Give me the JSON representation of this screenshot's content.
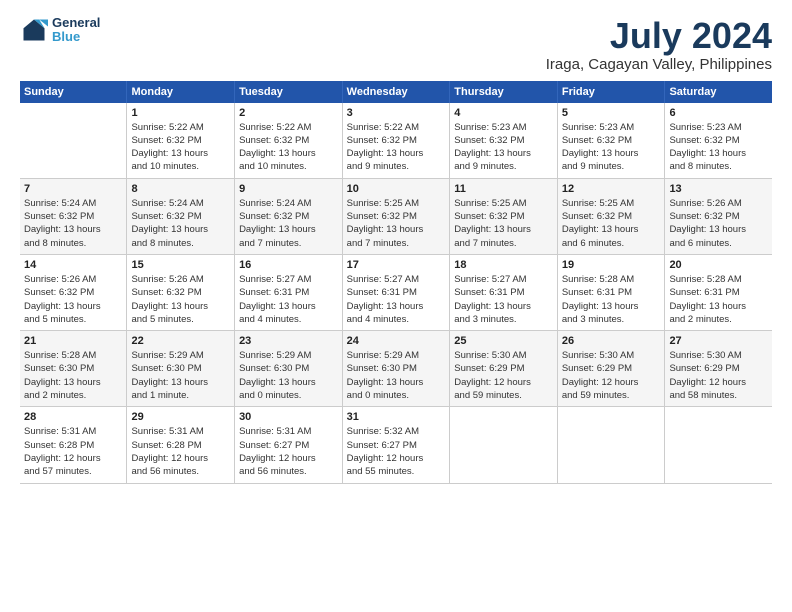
{
  "header": {
    "logo_line1": "General",
    "logo_line2": "Blue",
    "month_title": "July 2024",
    "location": "Iraga, Cagayan Valley, Philippines"
  },
  "days_of_week": [
    "Sunday",
    "Monday",
    "Tuesday",
    "Wednesday",
    "Thursday",
    "Friday",
    "Saturday"
  ],
  "weeks": [
    [
      {
        "num": "",
        "info": ""
      },
      {
        "num": "1",
        "info": "Sunrise: 5:22 AM\nSunset: 6:32 PM\nDaylight: 13 hours\nand 10 minutes."
      },
      {
        "num": "2",
        "info": "Sunrise: 5:22 AM\nSunset: 6:32 PM\nDaylight: 13 hours\nand 10 minutes."
      },
      {
        "num": "3",
        "info": "Sunrise: 5:22 AM\nSunset: 6:32 PM\nDaylight: 13 hours\nand 9 minutes."
      },
      {
        "num": "4",
        "info": "Sunrise: 5:23 AM\nSunset: 6:32 PM\nDaylight: 13 hours\nand 9 minutes."
      },
      {
        "num": "5",
        "info": "Sunrise: 5:23 AM\nSunset: 6:32 PM\nDaylight: 13 hours\nand 9 minutes."
      },
      {
        "num": "6",
        "info": "Sunrise: 5:23 AM\nSunset: 6:32 PM\nDaylight: 13 hours\nand 8 minutes."
      }
    ],
    [
      {
        "num": "7",
        "info": "Sunrise: 5:24 AM\nSunset: 6:32 PM\nDaylight: 13 hours\nand 8 minutes."
      },
      {
        "num": "8",
        "info": "Sunrise: 5:24 AM\nSunset: 6:32 PM\nDaylight: 13 hours\nand 8 minutes."
      },
      {
        "num": "9",
        "info": "Sunrise: 5:24 AM\nSunset: 6:32 PM\nDaylight: 13 hours\nand 7 minutes."
      },
      {
        "num": "10",
        "info": "Sunrise: 5:25 AM\nSunset: 6:32 PM\nDaylight: 13 hours\nand 7 minutes."
      },
      {
        "num": "11",
        "info": "Sunrise: 5:25 AM\nSunset: 6:32 PM\nDaylight: 13 hours\nand 7 minutes."
      },
      {
        "num": "12",
        "info": "Sunrise: 5:25 AM\nSunset: 6:32 PM\nDaylight: 13 hours\nand 6 minutes."
      },
      {
        "num": "13",
        "info": "Sunrise: 5:26 AM\nSunset: 6:32 PM\nDaylight: 13 hours\nand 6 minutes."
      }
    ],
    [
      {
        "num": "14",
        "info": "Sunrise: 5:26 AM\nSunset: 6:32 PM\nDaylight: 13 hours\nand 5 minutes."
      },
      {
        "num": "15",
        "info": "Sunrise: 5:26 AM\nSunset: 6:32 PM\nDaylight: 13 hours\nand 5 minutes."
      },
      {
        "num": "16",
        "info": "Sunrise: 5:27 AM\nSunset: 6:31 PM\nDaylight: 13 hours\nand 4 minutes."
      },
      {
        "num": "17",
        "info": "Sunrise: 5:27 AM\nSunset: 6:31 PM\nDaylight: 13 hours\nand 4 minutes."
      },
      {
        "num": "18",
        "info": "Sunrise: 5:27 AM\nSunset: 6:31 PM\nDaylight: 13 hours\nand 3 minutes."
      },
      {
        "num": "19",
        "info": "Sunrise: 5:28 AM\nSunset: 6:31 PM\nDaylight: 13 hours\nand 3 minutes."
      },
      {
        "num": "20",
        "info": "Sunrise: 5:28 AM\nSunset: 6:31 PM\nDaylight: 13 hours\nand 2 minutes."
      }
    ],
    [
      {
        "num": "21",
        "info": "Sunrise: 5:28 AM\nSunset: 6:30 PM\nDaylight: 13 hours\nand 2 minutes."
      },
      {
        "num": "22",
        "info": "Sunrise: 5:29 AM\nSunset: 6:30 PM\nDaylight: 13 hours\nand 1 minute."
      },
      {
        "num": "23",
        "info": "Sunrise: 5:29 AM\nSunset: 6:30 PM\nDaylight: 13 hours\nand 0 minutes."
      },
      {
        "num": "24",
        "info": "Sunrise: 5:29 AM\nSunset: 6:30 PM\nDaylight: 13 hours\nand 0 minutes."
      },
      {
        "num": "25",
        "info": "Sunrise: 5:30 AM\nSunset: 6:29 PM\nDaylight: 12 hours\nand 59 minutes."
      },
      {
        "num": "26",
        "info": "Sunrise: 5:30 AM\nSunset: 6:29 PM\nDaylight: 12 hours\nand 59 minutes."
      },
      {
        "num": "27",
        "info": "Sunrise: 5:30 AM\nSunset: 6:29 PM\nDaylight: 12 hours\nand 58 minutes."
      }
    ],
    [
      {
        "num": "28",
        "info": "Sunrise: 5:31 AM\nSunset: 6:28 PM\nDaylight: 12 hours\nand 57 minutes."
      },
      {
        "num": "29",
        "info": "Sunrise: 5:31 AM\nSunset: 6:28 PM\nDaylight: 12 hours\nand 56 minutes."
      },
      {
        "num": "30",
        "info": "Sunrise: 5:31 AM\nSunset: 6:27 PM\nDaylight: 12 hours\nand 56 minutes."
      },
      {
        "num": "31",
        "info": "Sunrise: 5:32 AM\nSunset: 6:27 PM\nDaylight: 12 hours\nand 55 minutes."
      },
      {
        "num": "",
        "info": ""
      },
      {
        "num": "",
        "info": ""
      },
      {
        "num": "",
        "info": ""
      }
    ]
  ]
}
